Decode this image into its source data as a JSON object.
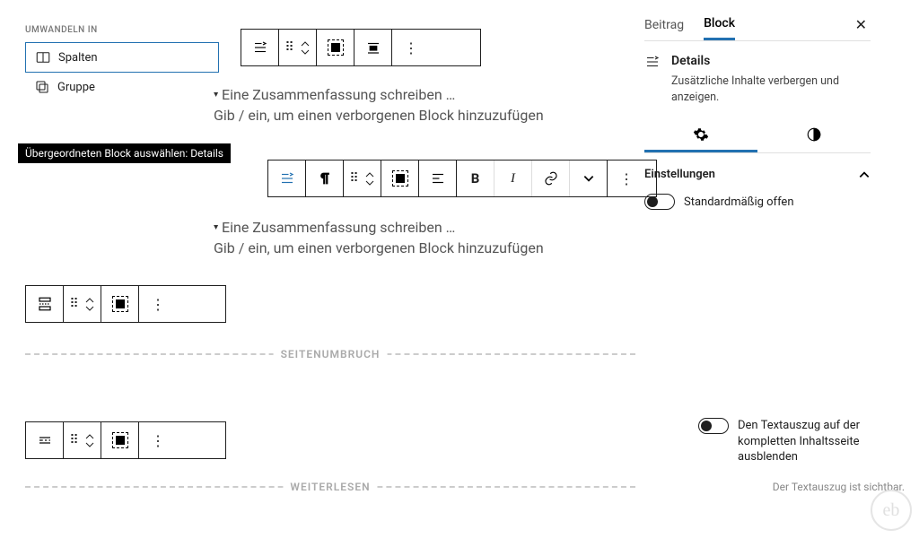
{
  "transform": {
    "heading": "UMWANDELN IN",
    "items": [
      {
        "label": "Spalten",
        "icon": "columns-icon",
        "selected": true
      },
      {
        "label": "Gruppe",
        "icon": "group-icon",
        "selected": false
      }
    ]
  },
  "tooltip": "Übergeordneten Block auswählen: Details",
  "details_block": {
    "summary_placeholder": "Eine Zusammenfassung schreiben …",
    "hint": "Gib / ein, um einen verborgenen Block hinzuzufügen"
  },
  "separators": {
    "page_break": "SEITENUMBRUCH",
    "read_more": "WEITERLESEN"
  },
  "sidebar": {
    "tabs": {
      "post": "Beitrag",
      "block": "Block"
    },
    "block_name": "Details",
    "block_desc": "Zusätzliche Inhalte verbergen und anzeigen.",
    "subtabs": {
      "settings": "settings-icon",
      "styles": "styles-icon"
    },
    "section_settings": "Einstellungen",
    "open_by_default": "Standardmäßig offen"
  },
  "excerpt": {
    "label": "Den Textauszug auf der kompletten Inhaltsseite ausblenden",
    "hint": "Der Textauszug ist sichtbar."
  },
  "watermark": "eb"
}
